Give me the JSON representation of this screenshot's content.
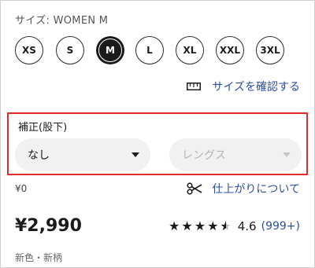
{
  "size": {
    "label": "サイズ: WOMEN M",
    "options": [
      "XS",
      "S",
      "M",
      "L",
      "XL",
      "XXL",
      "3XL"
    ],
    "selected": "M"
  },
  "size_guide": {
    "label": "サイズを確認する",
    "icon": "ruler-icon"
  },
  "hem": {
    "label": "補正(股下)",
    "type_select": {
      "value": "なし"
    },
    "length_select": {
      "placeholder": "レングス",
      "disabled": true
    },
    "highlight_color": "#e22b2b"
  },
  "fee": "¥0",
  "finish_link": {
    "label": "仕上がりについて",
    "icon": "scissors-icon"
  },
  "product": {
    "price": "¥2,990",
    "rating": {
      "stars": 4.5,
      "score": "4.6",
      "count": "(999+)"
    },
    "tags": "新色・新柄"
  },
  "colors": {
    "link": "#2b4f9f",
    "text": "#1b1b1b",
    "accent_border": "#e22b2b"
  }
}
